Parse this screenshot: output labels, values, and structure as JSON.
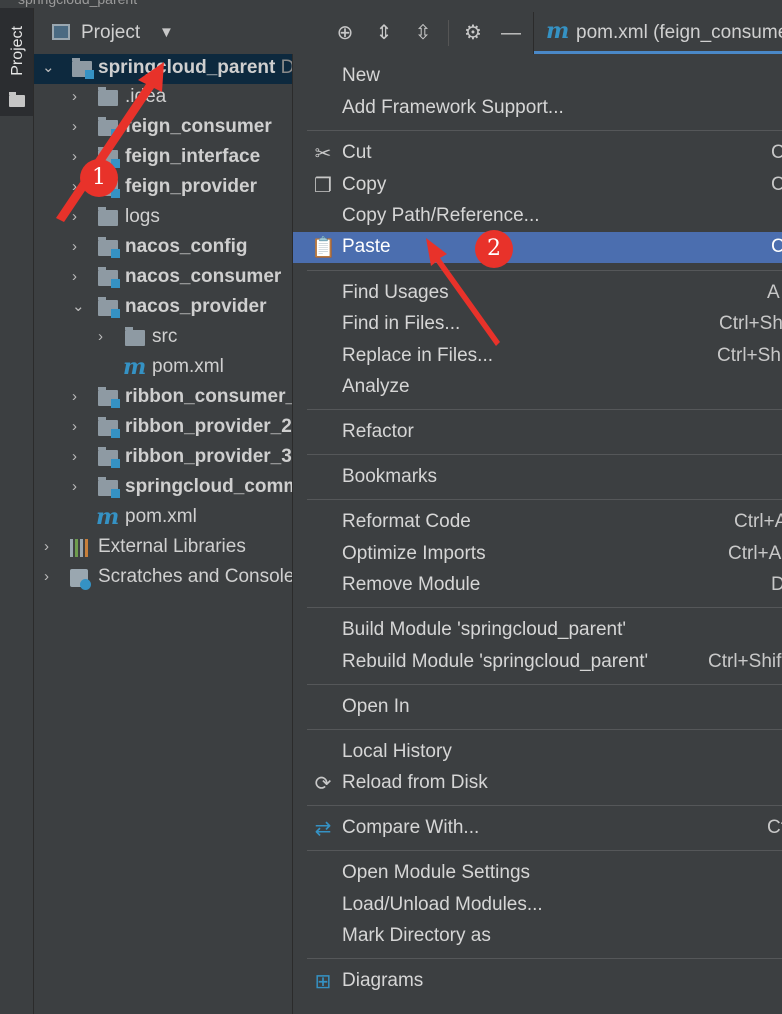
{
  "window_title_fragment": "springcloud_parent",
  "side_stripe": {
    "tab_label": "Project"
  },
  "project_panel": {
    "title": "Project"
  },
  "toolbar": {
    "icons": [
      "locate-icon",
      "expand-all-icon",
      "collapse-all-icon",
      "settings-icon",
      "hide-icon"
    ]
  },
  "editor_tab": {
    "icon_letter": "m",
    "label": "pom.xml (feign_consumer)"
  },
  "tree": {
    "root": {
      "label": "springcloud_parent",
      "suffix": "D"
    },
    "items": [
      {
        "label": ".idea"
      },
      {
        "label": "feign_consumer"
      },
      {
        "label": "feign_interface"
      },
      {
        "label": "feign_provider"
      },
      {
        "label": "logs"
      },
      {
        "label": "nacos_config"
      },
      {
        "label": "nacos_consumer"
      },
      {
        "label": "nacos_provider"
      },
      {
        "label": "src"
      },
      {
        "label": "pom.xml"
      },
      {
        "label": "ribbon_consumer_"
      },
      {
        "label": "ribbon_provider_2"
      },
      {
        "label": "ribbon_provider_3"
      },
      {
        "label": "springcloud_comm"
      },
      {
        "label": "pom.xml"
      },
      {
        "label": "External Libraries"
      },
      {
        "label": "Scratches and Console"
      }
    ]
  },
  "context_menu": {
    "items": [
      {
        "label": "New",
        "shortcut": ""
      },
      {
        "label": "Add Framework Support...",
        "shortcut": ""
      },
      {
        "label": "Cut",
        "shortcut": "C"
      },
      {
        "label": "Copy",
        "shortcut": "C"
      },
      {
        "label": "Copy Path/Reference...",
        "shortcut": ""
      },
      {
        "label": "Paste",
        "shortcut": "C"
      },
      {
        "label": "Find Usages",
        "shortcut": "A"
      },
      {
        "label": "Find in Files...",
        "shortcut": "Ctrl+Sh"
      },
      {
        "label": "Replace in Files...",
        "shortcut": "Ctrl+Sh"
      },
      {
        "label": "Analyze",
        "shortcut": ""
      },
      {
        "label": "Refactor",
        "shortcut": ""
      },
      {
        "label": "Bookmarks",
        "shortcut": ""
      },
      {
        "label": "Reformat Code",
        "shortcut": "Ctrl+A"
      },
      {
        "label": "Optimize Imports",
        "shortcut": "Ctrl+A"
      },
      {
        "label": "Remove Module",
        "shortcut": "D"
      },
      {
        "label": "Build Module 'springcloud_parent'",
        "shortcut": ""
      },
      {
        "label": "Rebuild Module 'springcloud_parent'",
        "shortcut": "Ctrl+Shif"
      },
      {
        "label": "Open In",
        "shortcut": ""
      },
      {
        "label": "Local History",
        "shortcut": ""
      },
      {
        "label": "Reload from Disk",
        "shortcut": ""
      },
      {
        "label": "Compare With...",
        "shortcut": "Ct"
      },
      {
        "label": "Open Module Settings",
        "shortcut": ""
      },
      {
        "label": "Load/Unload Modules...",
        "shortcut": ""
      },
      {
        "label": "Mark Directory as",
        "shortcut": ""
      },
      {
        "label": "Diagrams",
        "shortcut": ""
      }
    ]
  },
  "annotations": {
    "badge_1": "1",
    "badge_2": "2",
    "color": "#e8322a"
  }
}
